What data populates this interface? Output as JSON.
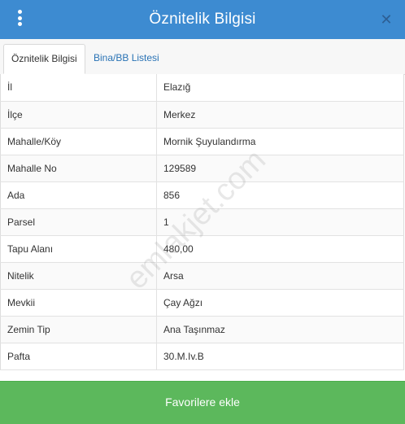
{
  "header": {
    "title": "Öznitelik Bilgisi"
  },
  "icons": {
    "menu": "more-vertical-icon",
    "close": "close-icon"
  },
  "tabs": [
    {
      "label": "Öznitelik Bilgisi",
      "active": true
    },
    {
      "label": "Bina/BB Listesi",
      "active": false
    }
  ],
  "rows": [
    {
      "key": "İl",
      "value": "Elazığ"
    },
    {
      "key": "İlçe",
      "value": "Merkez"
    },
    {
      "key": "Mahalle/Köy",
      "value": "Mornik Şuyulandırma"
    },
    {
      "key": "Mahalle No",
      "value": "129589"
    },
    {
      "key": "Ada",
      "value": "856"
    },
    {
      "key": "Parsel",
      "value": "1"
    },
    {
      "key": "Tapu Alanı",
      "value": "480,00"
    },
    {
      "key": "Nitelik",
      "value": "Arsa"
    },
    {
      "key": "Mevkii",
      "value": "Çay Ağzı"
    },
    {
      "key": "Zemin Tip",
      "value": "Ana Taşınmaz"
    },
    {
      "key": "Pafta",
      "value": "30.M.Iv.B"
    }
  ],
  "footer": {
    "favorite_label": "Favorilere ekle"
  },
  "watermark": "emlakjet.com",
  "colors": {
    "header": "#3d8bd1",
    "button": "#5cb85c",
    "link": "#2a73b5"
  }
}
